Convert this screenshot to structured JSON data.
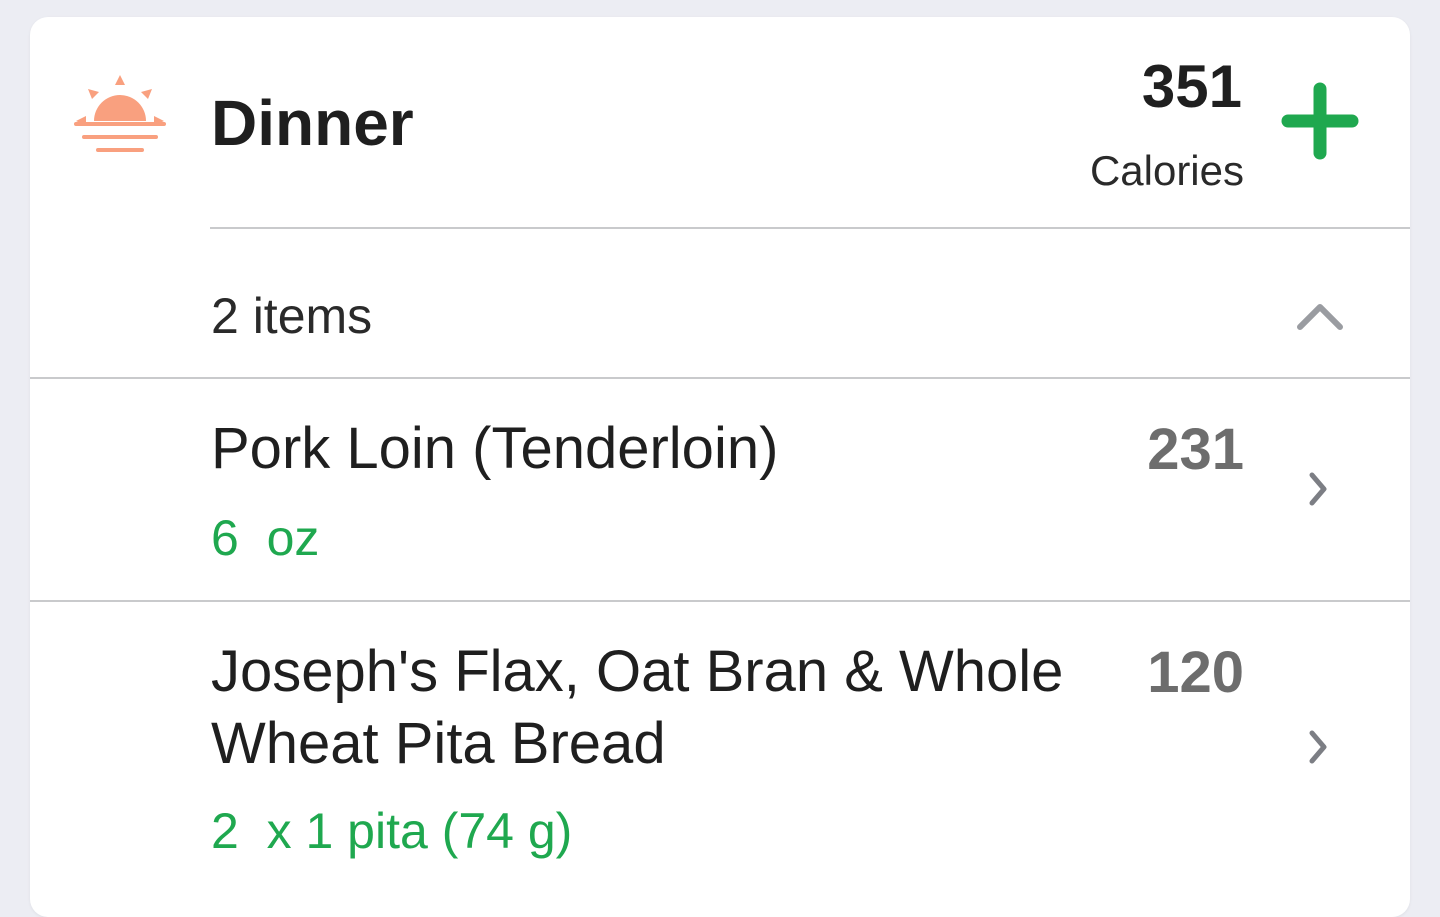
{
  "meal": {
    "title": "Dinner",
    "icon": "sunset-icon",
    "total_calories": "351",
    "calories_label": "Calories",
    "add_icon": "plus-icon",
    "items_count_label": "2 items",
    "collapse_icon": "chevron-up-icon"
  },
  "foods": [
    {
      "name": "Pork Loin (Tenderloin)",
      "serving": "6  oz",
      "calories": "231"
    },
    {
      "name": "Joseph's Flax, Oat Bran & Whole Wheat Pita Bread",
      "serving": "2  x 1 pita (74 g)",
      "calories": "120"
    }
  ],
  "colors": {
    "background": "#ecedf3",
    "card": "#ffffff",
    "accent_green": "#1fa84f",
    "sunset_orange": "#f9a07f",
    "divider": "#c9cacc",
    "calorie_gray": "#6d6d6d"
  }
}
